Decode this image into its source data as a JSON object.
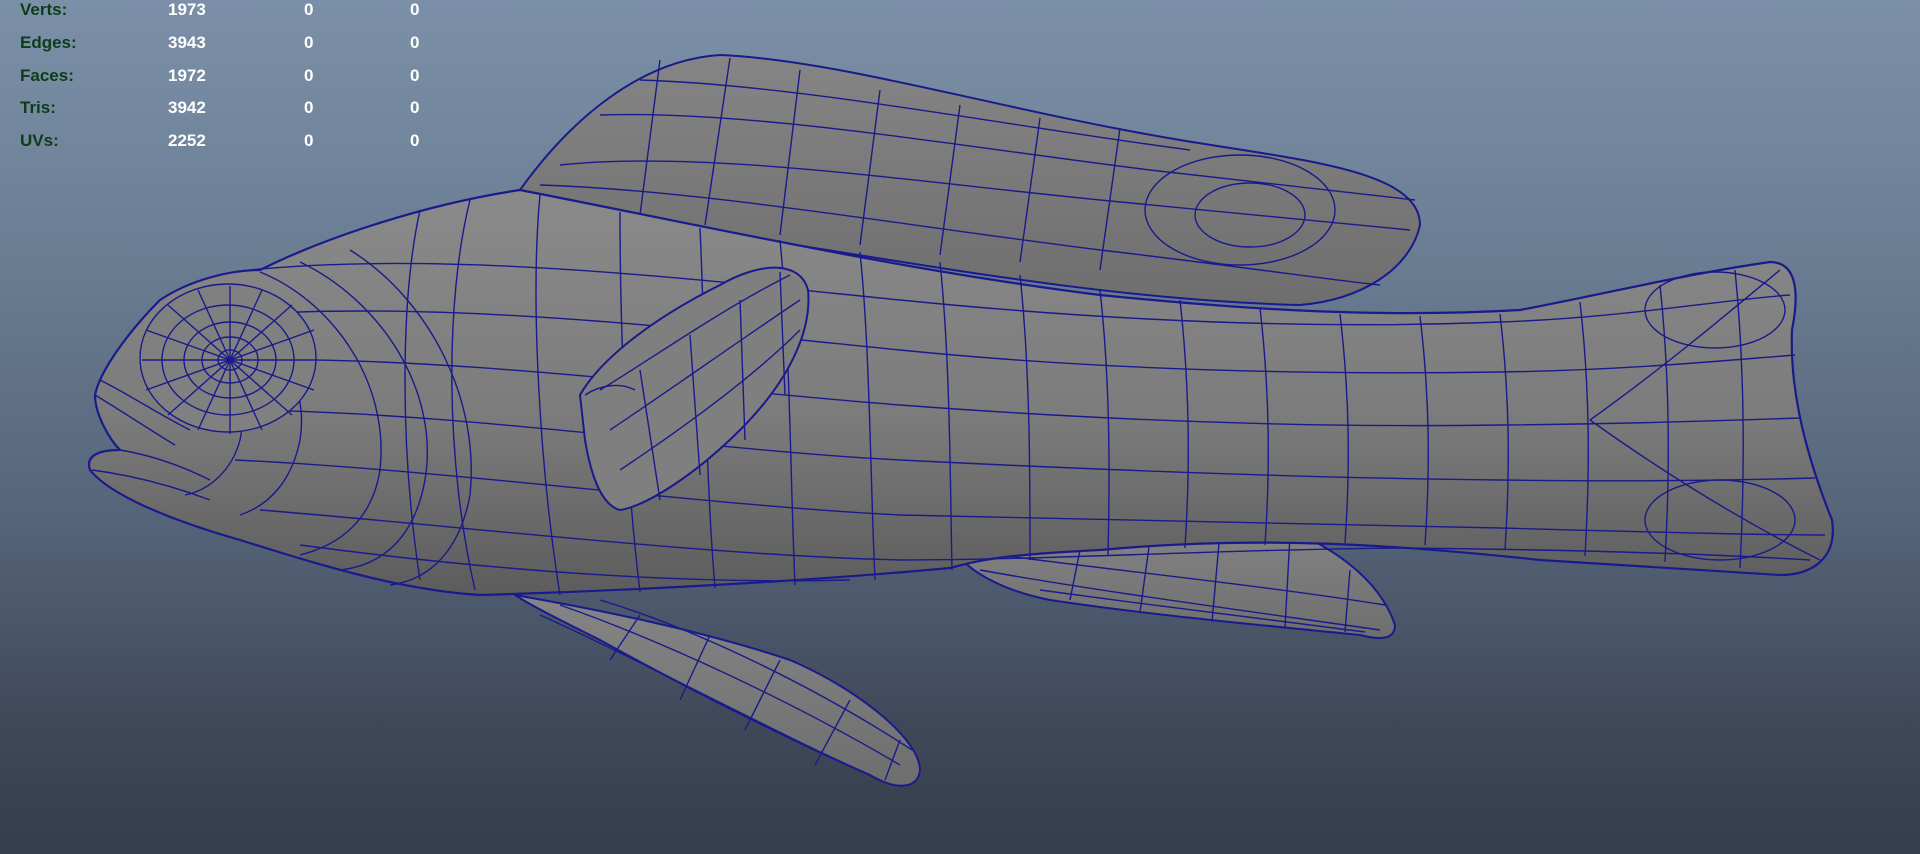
{
  "poly_count": {
    "rows": [
      {
        "label": "Verts:",
        "values": [
          "1973",
          "0",
          "0"
        ]
      },
      {
        "label": "Edges:",
        "values": [
          "3943",
          "0",
          "0"
        ]
      },
      {
        "label": "Faces:",
        "values": [
          "1972",
          "0",
          "0"
        ]
      },
      {
        "label": "Tris:",
        "values": [
          "3942",
          "0",
          "0"
        ]
      },
      {
        "label": "UVs:",
        "values": [
          "2252",
          "0",
          "0"
        ]
      }
    ]
  },
  "viewport": {
    "background_top": "#7b90a8",
    "background_bottom": "#363d4c",
    "mesh_fill": "#7d7d7d",
    "wire_color": "#1a1a8c",
    "hud_label_color": "#0d3d17",
    "hud_value_color": "#ffffff",
    "model": "fish-wireframe-mesh"
  }
}
